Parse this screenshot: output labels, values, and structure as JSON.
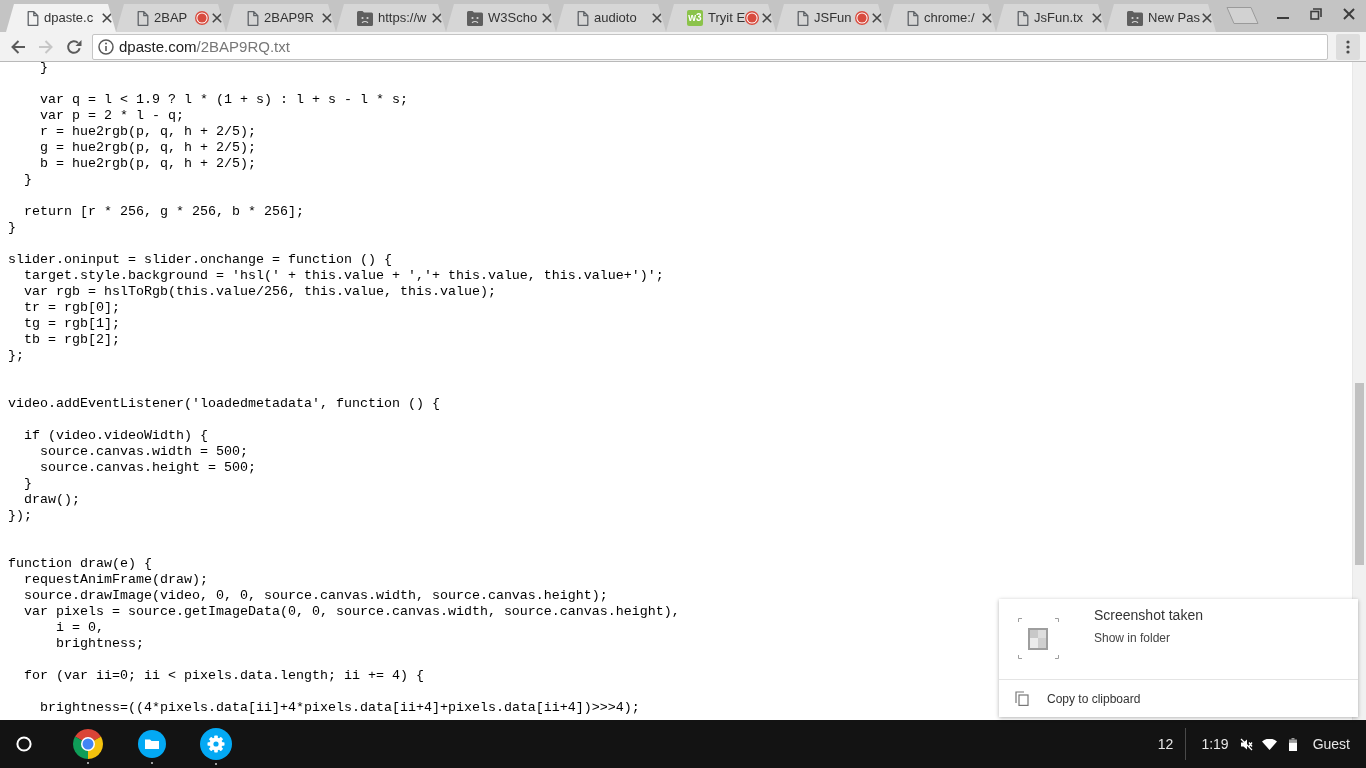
{
  "tabs": [
    {
      "title": "dpaste.c",
      "kind": "file",
      "recording": false,
      "selected": true
    },
    {
      "title": "2BAP",
      "kind": "file",
      "recording": true,
      "selected": false
    },
    {
      "title": "2BAP9R",
      "kind": "file",
      "recording": false,
      "selected": false
    },
    {
      "title": "https://w",
      "kind": "crashed",
      "recording": false,
      "selected": false
    },
    {
      "title": "W3Scho",
      "kind": "crashed",
      "recording": false,
      "selected": false
    },
    {
      "title": "audioto",
      "kind": "file",
      "recording": false,
      "selected": false
    },
    {
      "title": "Tryit E",
      "kind": "logo",
      "logo_text": "w3",
      "recording": true,
      "selected": false
    },
    {
      "title": "JSFun",
      "kind": "file",
      "recording": true,
      "selected": false
    },
    {
      "title": "chrome:/",
      "kind": "file",
      "recording": false,
      "selected": false
    },
    {
      "title": "JsFun.tx",
      "kind": "file",
      "recording": false,
      "selected": false
    },
    {
      "title": "New Pas",
      "kind": "crashed",
      "recording": false,
      "selected": false
    }
  ],
  "toolbar": {
    "nav": [
      {
        "kind": "back",
        "disabled": false
      },
      {
        "kind": "forward",
        "disabled": true
      },
      {
        "kind": "reload",
        "disabled": false
      }
    ],
    "url": {
      "host": "dpaste.com",
      "path": "/2BAP9RQ.txt"
    }
  },
  "code_lines": [
    {
      "kind": "code",
      "text": "    }"
    },
    {
      "kind": "blank"
    },
    {
      "kind": "code",
      "text": "    var q = l < 1.9 ? l * (1 + s) : l + s - l * s;"
    },
    {
      "kind": "code",
      "text": "    var p = 2 * l - q;"
    },
    {
      "kind": "code",
      "text": "    r = hue2rgb(p, q, h + 2/5);"
    },
    {
      "kind": "code",
      "text": "    g = hue2rgb(p, q, h + 2/5);"
    },
    {
      "kind": "code",
      "text": "    b = hue2rgb(p, q, h + 2/5);"
    },
    {
      "kind": "code",
      "text": "  }"
    },
    {
      "kind": "blank"
    },
    {
      "kind": "code",
      "text": "  return [r * 256, g * 256, b * 256];"
    },
    {
      "kind": "code",
      "text": "}"
    },
    {
      "kind": "blank"
    },
    {
      "kind": "code",
      "text": "slider.oninput = slider.onchange = function () {"
    },
    {
      "kind": "code",
      "text": "  target.style.background = 'hsl(' + this.value + ','+ this.value, this.value+')';"
    },
    {
      "kind": "code",
      "text": "  var rgb = hslToRgb(this.value/256, this.value, this.value);"
    },
    {
      "kind": "code",
      "text": "  tr = rgb[0];"
    },
    {
      "kind": "code",
      "text": "  tg = rgb[1];"
    },
    {
      "kind": "code",
      "text": "  tb = rgb[2];"
    },
    {
      "kind": "code",
      "text": "};"
    },
    {
      "kind": "blank"
    },
    {
      "kind": "blank"
    },
    {
      "kind": "code",
      "text": "video.addEventListener('loadedmetadata', function () {"
    },
    {
      "kind": "blank"
    },
    {
      "kind": "code",
      "text": "  if (video.videoWidth) {"
    },
    {
      "kind": "code",
      "text": "    source.canvas.width = 500;"
    },
    {
      "kind": "code",
      "text": "    source.canvas.height = 500;"
    },
    {
      "kind": "code",
      "text": "  }"
    },
    {
      "kind": "code",
      "text": "  draw();"
    },
    {
      "kind": "code",
      "text": "});"
    },
    {
      "kind": "blank"
    },
    {
      "kind": "blank"
    },
    {
      "kind": "code",
      "text": "function draw(e) {"
    },
    {
      "kind": "code",
      "text": "  requestAnimFrame(draw);"
    },
    {
      "kind": "code",
      "text": "  source.drawImage(video, 0, 0, source.canvas.width, source.canvas.height);"
    },
    {
      "kind": "code",
      "text": "  var pixels = source.getImageData(0, 0, source.canvas.width, source.canvas.height),"
    },
    {
      "kind": "code",
      "text": "      i = 0,"
    },
    {
      "kind": "code",
      "text": "      brightness;"
    },
    {
      "kind": "blank"
    },
    {
      "kind": "code",
      "text": "  for (var ii=0; ii < pixels.data.length; ii += 4) {"
    },
    {
      "kind": "blank"
    },
    {
      "kind": "code",
      "text": "    brightness=((4*pixels.data[ii]+4*pixels.data[ii+4]+pixels.data[ii+4])>>>4);"
    }
  ],
  "notification": {
    "title": "Screenshot taken",
    "action": "Show in folder",
    "button": "Copy to clipboard"
  },
  "taskbar": {
    "apps": [
      {
        "kind": "browser",
        "running": true
      },
      {
        "kind": "files",
        "running": true
      },
      {
        "kind": "settings",
        "running": true
      }
    ],
    "notification_count": "12",
    "time": "1:19",
    "user": "Guest"
  }
}
